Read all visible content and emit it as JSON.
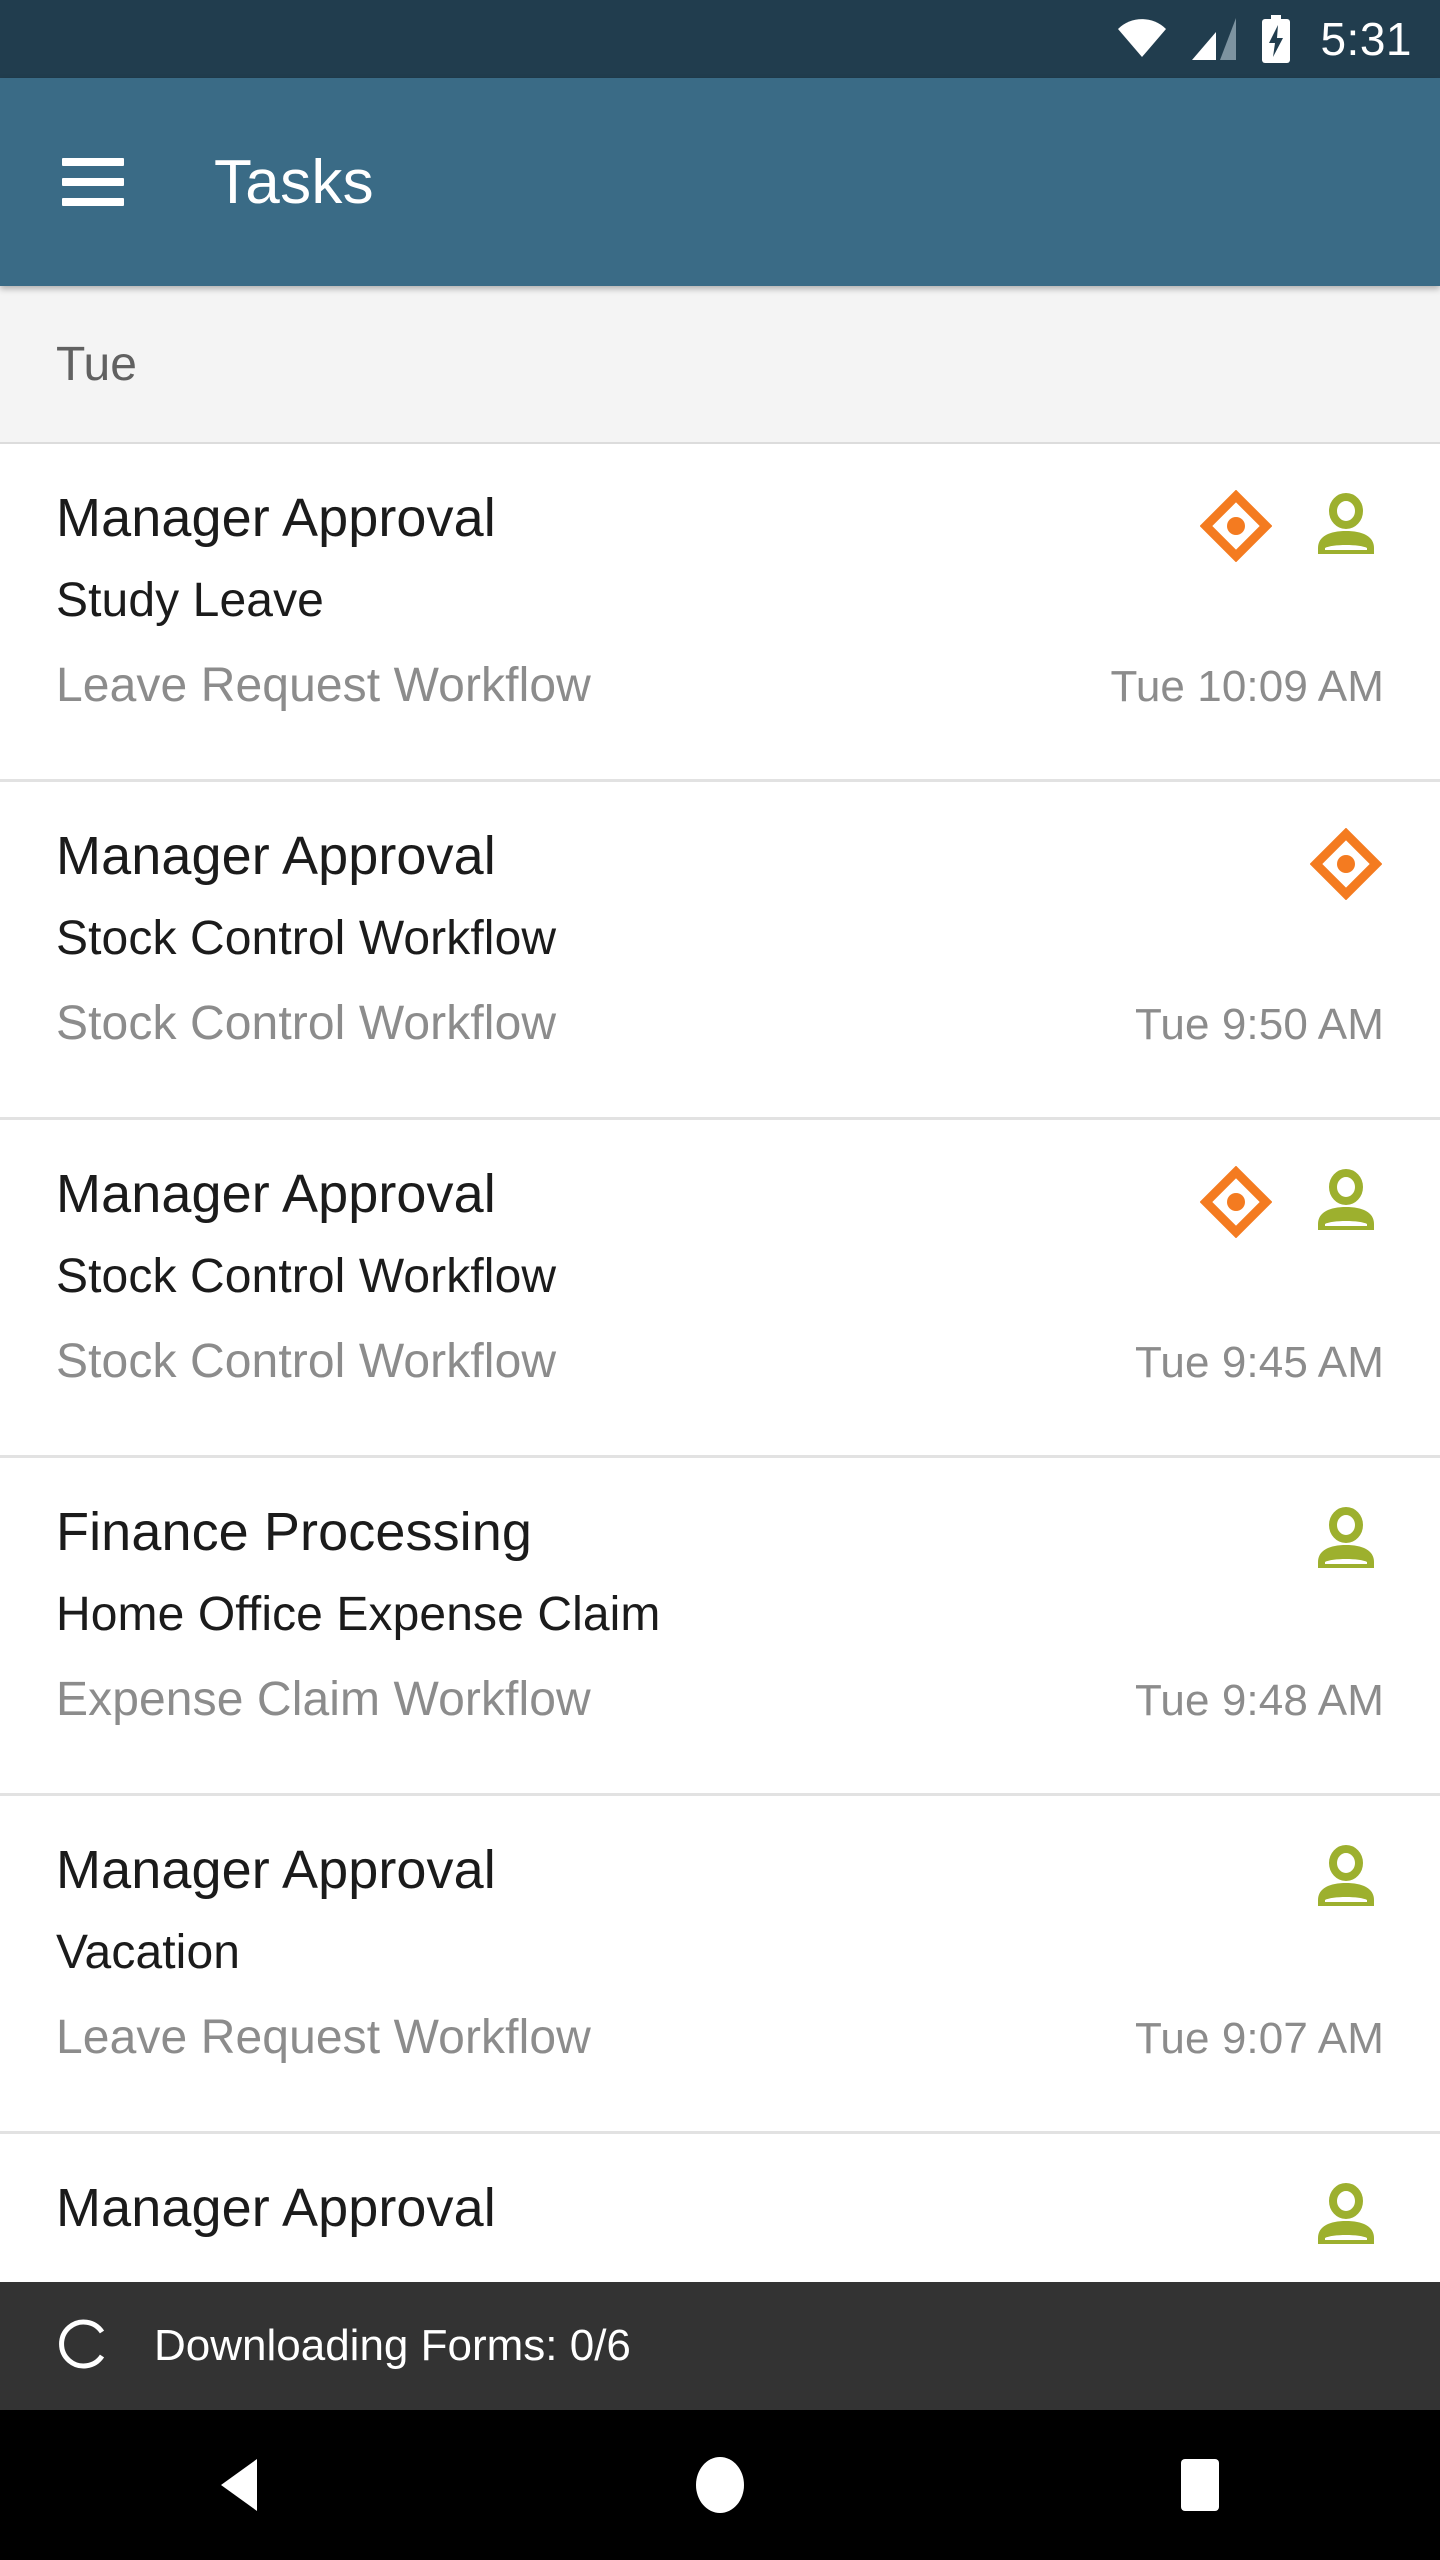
{
  "status_bar": {
    "time": "5:31",
    "wifi_icon": "wifi-icon",
    "signal_icon": "cellular-signal-icon",
    "battery_icon": "battery-charging-icon",
    "background_color": "#213d4e"
  },
  "toolbar": {
    "title": "Tasks",
    "menu_icon": "hamburger-menu-icon",
    "background_color": "#3a6b86"
  },
  "section_header": {
    "label": "Tue",
    "background_color": "#f4f4f4"
  },
  "colors": {
    "priority_orange": "#f47b20",
    "assignee_green": "#9db02e",
    "title_text": "#1b1b1b",
    "muted_text": "#8c8c8c",
    "divider": "#e2e2e2"
  },
  "tasks": [
    {
      "title": "Manager Approval",
      "subtitle": "Study Leave",
      "workflow": "Leave Request Workflow",
      "time": "Tue 10:09 AM",
      "priority_icon": true,
      "assignee_icon": true
    },
    {
      "title": "Manager Approval",
      "subtitle": "Stock Control Workflow",
      "workflow": "Stock Control Workflow",
      "time": "Tue 9:50 AM",
      "priority_icon": true,
      "assignee_icon": false
    },
    {
      "title": "Manager Approval",
      "subtitle": "Stock Control Workflow",
      "workflow": "Stock Control Workflow",
      "time": "Tue 9:45 AM",
      "priority_icon": true,
      "assignee_icon": true
    },
    {
      "title": "Finance Processing",
      "subtitle": "Home Office Expense Claim",
      "workflow": "Expense Claim Workflow",
      "time": "Tue 9:48 AM",
      "priority_icon": false,
      "assignee_icon": true
    },
    {
      "title": "Manager Approval",
      "subtitle": "Vacation",
      "workflow": "Leave Request Workflow",
      "time": "Tue 9:07 AM",
      "priority_icon": false,
      "assignee_icon": true
    },
    {
      "title": "Manager Approval",
      "subtitle": "",
      "workflow": "",
      "time": "",
      "priority_icon": false,
      "assignee_icon": true
    }
  ],
  "snackbar": {
    "text": "Downloading Forms: 0/6",
    "spinner_icon": "loading-spinner-icon",
    "background_color": "#333333"
  },
  "nav_bar": {
    "back_label": "back-icon",
    "home_label": "home-icon",
    "recents_label": "recents-icon"
  }
}
